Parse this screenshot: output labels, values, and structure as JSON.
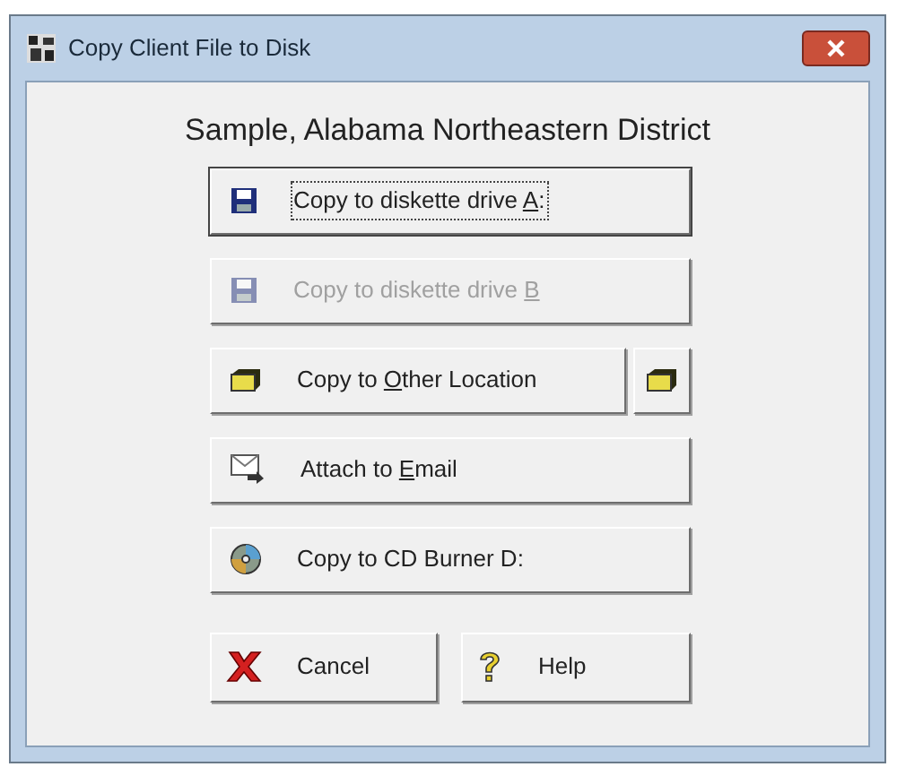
{
  "window": {
    "title": "Copy Client File to Disk"
  },
  "heading": "Sample, Alabama Northeastern District",
  "buttons": [
    {
      "kind": "floppy",
      "before": "Copy to diskette drive ",
      "key": "A",
      "after": ":",
      "focused": true,
      "disabled": false
    },
    {
      "kind": "floppy",
      "before": "Copy to diskette drive ",
      "key": "B",
      "focused": false,
      "disabled": true
    },
    {
      "kind": "folder",
      "before": "Copy to ",
      "key": "O",
      "after": "ther Location",
      "focused": false,
      "disabled": false,
      "browse": true
    },
    {
      "kind": "email",
      "before": "Attach to ",
      "key": "E",
      "after": "mail",
      "focused": false,
      "disabled": false
    },
    {
      "kind": "cd",
      "before": "Copy to CD Burner D:",
      "focused": false,
      "disabled": false
    }
  ],
  "footer": [
    {
      "kind": "cancel",
      "label": "Cancel"
    },
    {
      "kind": "help",
      "label": "Help"
    }
  ]
}
